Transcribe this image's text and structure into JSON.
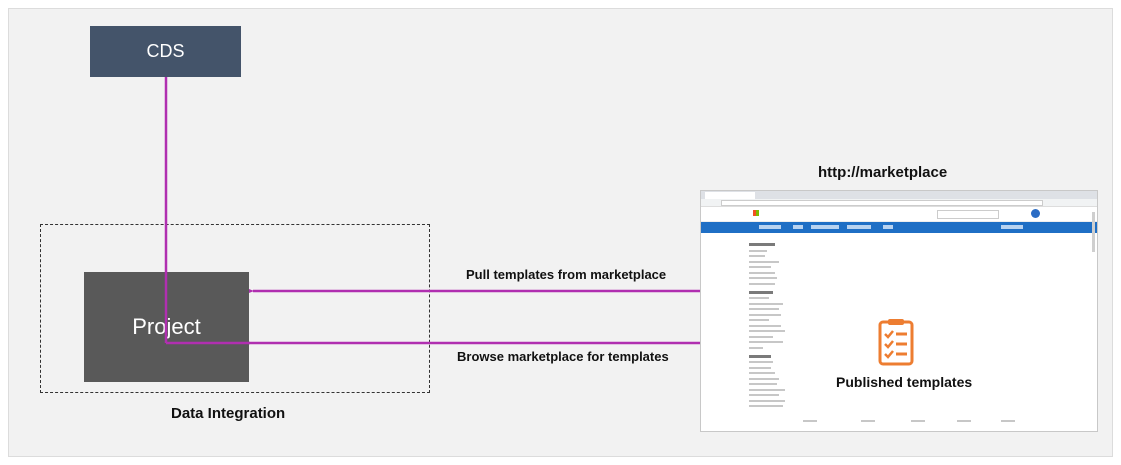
{
  "nodes": {
    "cds": "CDS",
    "project": "Project",
    "data_integration": "Data Integration",
    "marketplace_url": "http://marketplace",
    "published_templates": "Published templates"
  },
  "edges": {
    "pull": "Pull templates from marketplace",
    "browse": "Browse marketplace for templates"
  },
  "colors": {
    "connector": "#b02fb0",
    "cds_fill": "#44546a",
    "project_fill": "#595959",
    "icon_orange": "#ed7d31",
    "canvas": "#f2f2f2"
  },
  "icons": {
    "published": "checklist-icon"
  }
}
